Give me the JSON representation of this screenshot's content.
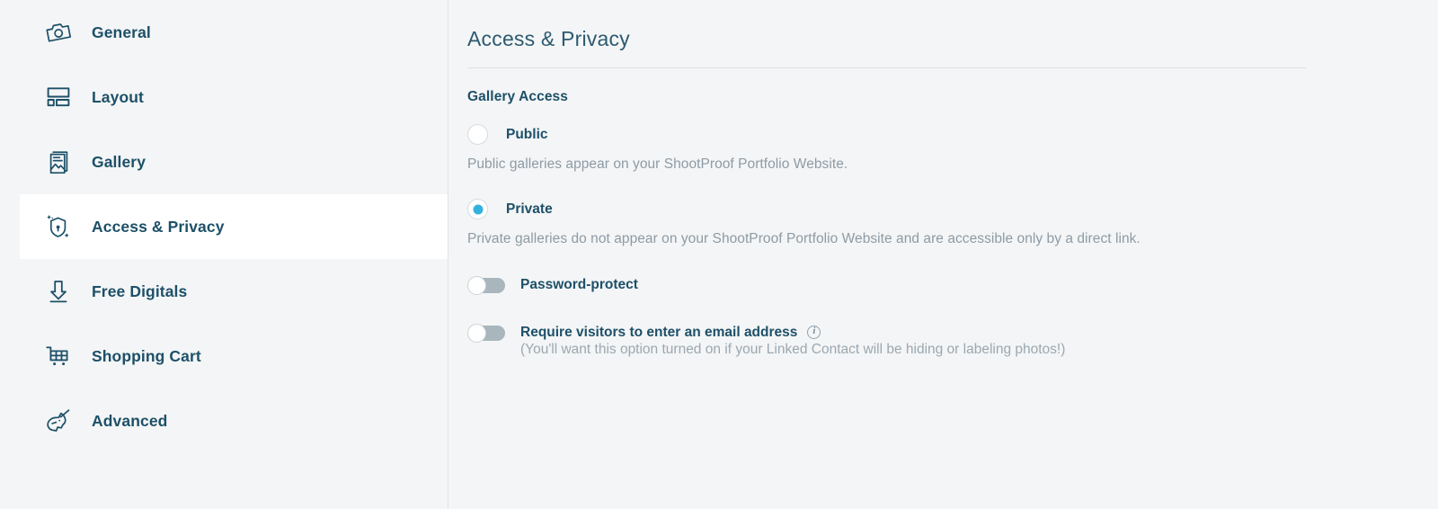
{
  "sidebar": {
    "items": [
      {
        "label": "General",
        "icon": "camera-icon",
        "active": false
      },
      {
        "label": "Layout",
        "icon": "layout-icon",
        "active": false
      },
      {
        "label": "Gallery",
        "icon": "gallery-photos-icon",
        "active": false
      },
      {
        "label": "Access & Privacy",
        "icon": "shield-lock-icon",
        "active": true
      },
      {
        "label": "Free Digitals",
        "icon": "download-arrow-icon",
        "active": false
      },
      {
        "label": "Shopping Cart",
        "icon": "shopping-cart-icon",
        "active": false
      },
      {
        "label": "Advanced",
        "icon": "unicorn-icon",
        "active": false
      }
    ]
  },
  "main": {
    "page_title": "Access & Privacy",
    "section_title": "Gallery Access",
    "options": [
      {
        "label": "Public",
        "selected": false,
        "description": "Public galleries appear on your ShootProof Portfolio Website."
      },
      {
        "label": "Private",
        "selected": true,
        "description": "Private galleries do not appear on your ShootProof Portfolio Website and are accessible only by a direct link."
      }
    ],
    "toggles": [
      {
        "label": "Password-protect",
        "on": false,
        "has_info": false,
        "sub": ""
      },
      {
        "label": "Require visitors to enter an email address",
        "on": false,
        "has_info": true,
        "info_icon": "info-circle-icon",
        "sub": "(You'll want this option turned on if your Linked Contact will be hiding or labeling photos!)"
      }
    ]
  },
  "colors": {
    "accent": "#35b1e0",
    "brand_dark": "#1d5068",
    "muted_text": "#8d9ba5",
    "page_bg": "#f4f5f6",
    "active_bg": "#ffffff",
    "toggle_off_track": "#a9b6bd"
  }
}
